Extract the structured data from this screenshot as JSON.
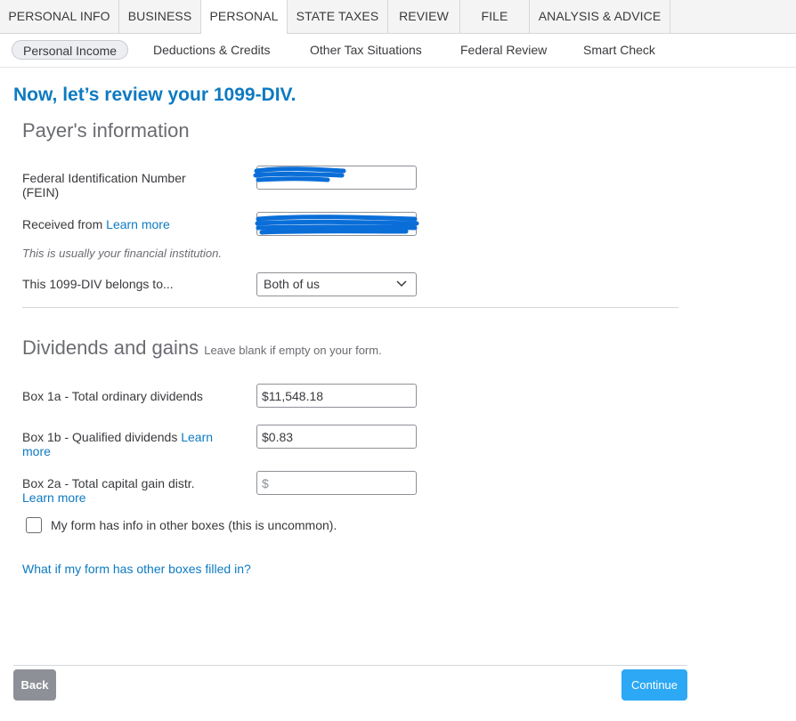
{
  "top_tabs": [
    {
      "label": "PERSONAL INFO"
    },
    {
      "label": "BUSINESS"
    },
    {
      "label": "PERSONAL"
    },
    {
      "label": "STATE TAXES"
    },
    {
      "label": "REVIEW"
    },
    {
      "label": "FILE"
    },
    {
      "label": "ANALYSIS & ADVICE"
    }
  ],
  "active_top_tab": "PERSONAL",
  "sub_tabs": [
    {
      "label": "Personal Income"
    },
    {
      "label": "Deductions & Credits"
    },
    {
      "label": "Other Tax Situations"
    },
    {
      "label": "Federal Review"
    },
    {
      "label": "Smart Check"
    }
  ],
  "active_sub_tab": "Personal Income",
  "page_title": "Now, let’s review your 1099-DIV.",
  "payer": {
    "section_title": "Payer's information",
    "fein_label_line1": "Federal Identification Number",
    "fein_label_line2": "(FEIN)",
    "received_from_label": "Received from",
    "learn_more": "Learn more",
    "received_hint": "This is usually your financial institution.",
    "belongs_label": "This 1099-DIV belongs to...",
    "belongs_value": "Both of us"
  },
  "dividends": {
    "section_title": "Dividends and gains",
    "section_hint": "Leave blank if empty on your form.",
    "box1a_label": "Box 1a - Total ordinary dividends",
    "box1a_value": "$11,548.18",
    "box1b_label": "Box 1b - Qualified dividends",
    "box1b_learn_line1": "Learn",
    "box1b_learn_line2": "more",
    "box1b_value": "$0.83",
    "box2a_label": "Box 2a - Total capital gain distr.",
    "box2a_learn": "Learn more",
    "box2a_placeholder": "$",
    "other_boxes_label": "My form has info in other boxes (this is uncommon).",
    "other_boxes_link": "What if my form has other boxes filled in?"
  },
  "buttons": {
    "back": "Back",
    "continue": "Continue"
  },
  "colors": {
    "accent": "#0d7ac1",
    "primary_button": "#2ca8f4",
    "secondary_button": "#8d9096",
    "redaction": "#0a6ed8"
  }
}
